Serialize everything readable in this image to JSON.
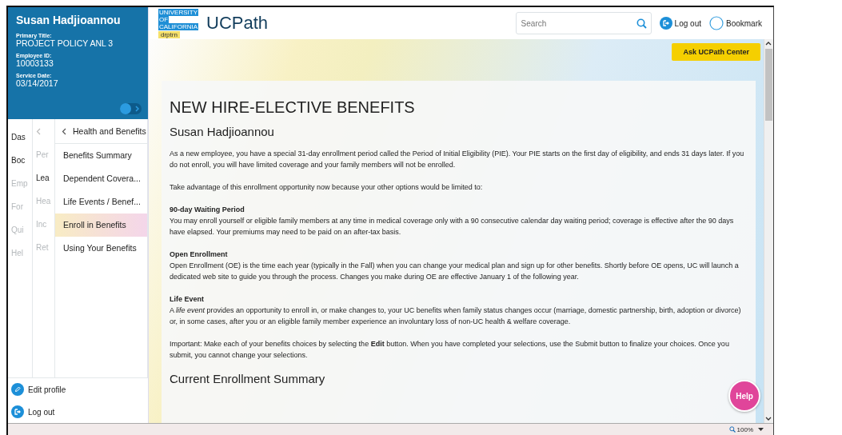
{
  "profile": {
    "name": "Susan Hadjioannou",
    "fields": [
      {
        "label": "Primary Title:",
        "value": "PROJECT POLICY ANL 3"
      },
      {
        "label": "Employee ID:",
        "value": "10003133"
      },
      {
        "label": "Service Date:",
        "value": "03/14/2017"
      }
    ],
    "toggle": {
      "on": false
    }
  },
  "nav": {
    "columns": [
      {
        "items": [
          {
            "label": "Das",
            "disabled": false
          },
          {
            "label": "Boc",
            "disabled": false
          },
          {
            "label": "Emp",
            "disabled": true
          },
          {
            "label": "For",
            "disabled": true
          },
          {
            "label": "Qui",
            "disabled": true
          },
          {
            "label": "Hel",
            "disabled": true
          }
        ]
      },
      {
        "items": [
          {
            "label": "Per",
            "disabled": true
          },
          {
            "label": "Lea",
            "disabled": false
          },
          {
            "label": "Hea",
            "disabled": true
          },
          {
            "label": "Inc",
            "disabled": true
          },
          {
            "label": "Ret",
            "disabled": true
          }
        ]
      }
    ],
    "submenu": {
      "title": "Health and Benefits",
      "items": [
        {
          "label": "Benefits Summary",
          "selected": false
        },
        {
          "label": "Dependent Covera...",
          "selected": false
        },
        {
          "label": "Life Events / Benef...",
          "selected": false
        },
        {
          "label": "Enroll in Benefits",
          "selected": true
        },
        {
          "label": "Using Your Benefits",
          "selected": false
        }
      ]
    }
  },
  "sidebar_footer": [
    {
      "kind": "edit",
      "label": "Edit profile"
    },
    {
      "kind": "logout",
      "label": "Log out"
    }
  ],
  "header": {
    "logo_lines": [
      "UNIVERSITY",
      "OF",
      "CALIFORNIA"
    ],
    "env_tag": "drptrn",
    "app_name": "UCPath",
    "search": {
      "placeholder": "Search"
    },
    "links": [
      {
        "kind": "logout",
        "label": "Log out"
      },
      {
        "kind": "bookmark",
        "label": "Bookmark"
      }
    ]
  },
  "ask_button": "Ask UCPath Center",
  "page": {
    "title": "NEW HIRE-ELECTIVE BENEFITS",
    "subtitle": "Susan Hadjioannou",
    "blocks": [
      {
        "text": "As a new employee, you have a special 31-day enrollment period called the Period of Initial Eligibility (PIE). Your PIE starts on the first day of eligibility, and ends 31 days later. If you do not enroll, you will have limited coverage and your family members will not be enrolled."
      },
      {
        "text": "Take advantage of this enrollment opportunity now because your other options would be limited to:"
      },
      {
        "heading": "90-day Waiting Period",
        "text": "You may enroll yourself or eligible family members at any time in medical coverage only with a 90 consecutive calendar day waiting period; coverage is effective after the 90 days have elapsed. Your premiums may need to be paid on an after-tax basis."
      },
      {
        "heading": "Open Enrollment",
        "text": "Open Enrollment (OE) is the time each year (typically in the Fall) when you can change your medical plan and sign up for other benefits. Shortly before OE opens, UC will launch a dedicated web site to guide you through the process. Changes you make during OE are effective January 1 of the following year."
      },
      {
        "heading": "Life Event",
        "text": "A *life event* provides an opportunity to enroll in, or make changes to, your UC benefits when family status changes occur (marriage, domestic partnership, birth, adoption or divorce) or, in some cases, after you or an eligible family member experience an involuntary loss of non-UC health & welfare coverage."
      },
      {
        "text": "Important: Make each of your benefits choices by selecting the **Edit** button. When you have completed your selections, use the Submit button to finalize your choices. Once you submit, you cannot change your selections."
      }
    ],
    "section_title": "Current Enrollment Summary"
  },
  "help_button": "Help",
  "status_bar": {
    "zoom": "100%"
  }
}
